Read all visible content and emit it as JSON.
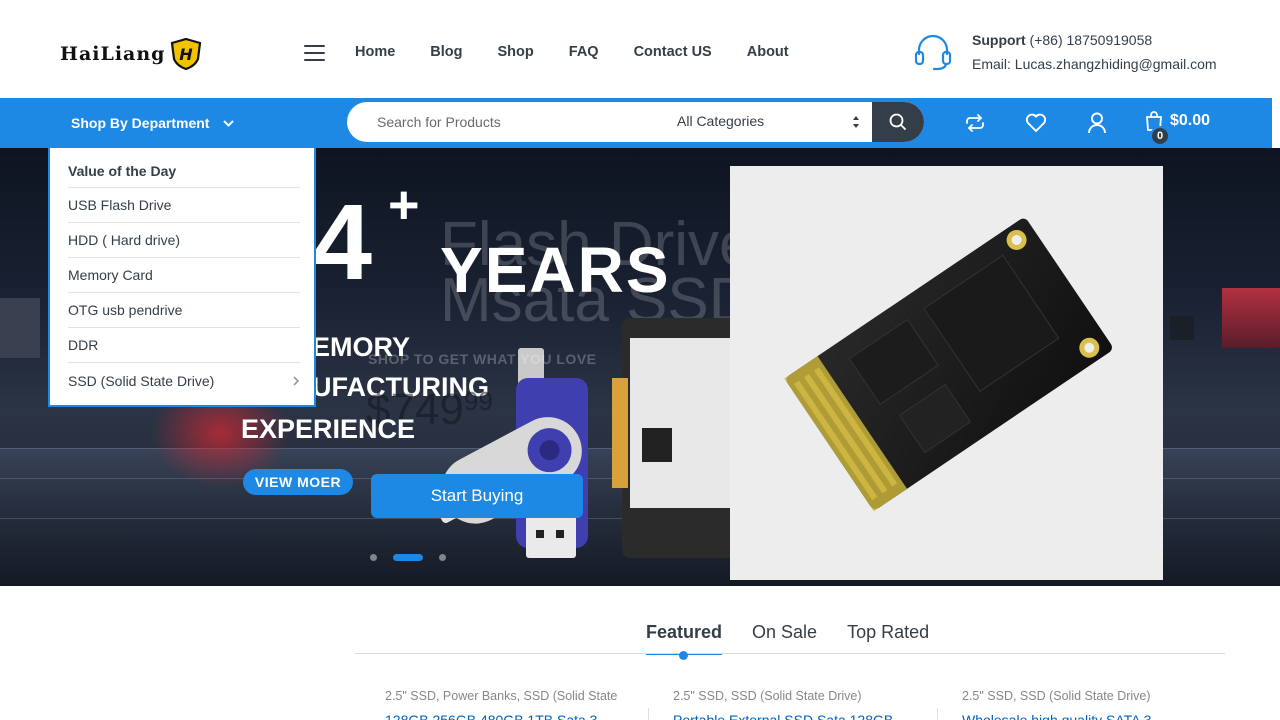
{
  "header": {
    "logo_text": "HaiLiang",
    "logo_badge_letter": "H",
    "nav": [
      "Home",
      "Blog",
      "Shop",
      "FAQ",
      "Contact US",
      "About"
    ],
    "support_label": "Support",
    "support_phone": "(+86) 18750919058",
    "support_email": "Email: Lucas.zhangzhiding@gmail.com"
  },
  "bar": {
    "department_label": "Shop By Department",
    "search_placeholder": "Search for Products",
    "category_selected": "All Categories",
    "cart_amount": "$0.00",
    "cart_count": "0"
  },
  "department_menu": [
    {
      "label": "Value of the Day",
      "has_sub": false
    },
    {
      "label": "USB Flash Drive",
      "has_sub": false
    },
    {
      "label": "HDD ( Hard drive)",
      "has_sub": false
    },
    {
      "label": "Memory Card",
      "has_sub": false
    },
    {
      "label": "OTG usb pendrive",
      "has_sub": false
    },
    {
      "label": "DDR",
      "has_sub": false
    },
    {
      "label": "SSD (Solid State Drive)",
      "has_sub": true
    }
  ],
  "hero": {
    "big_number": "4",
    "plus": "+",
    "years": "YEARS",
    "ghost_line1": "Flash Drive",
    "ghost_line2": "Msata SSD",
    "line_memory": "EMORY",
    "line_manuf": "UFACTURING",
    "line_experience": "EXPERIENCE",
    "shop_line": "SHOP TO GET WHAT YOU LOVE",
    "price_main": "$749",
    "price_cents": "99",
    "view_more": "VIEW MOER",
    "start_buying": "Start Buying",
    "slide_count": 3,
    "active_slide": 2
  },
  "tabs": [
    {
      "label": "Featured",
      "active": true
    },
    {
      "label": "On Sale",
      "active": false
    },
    {
      "label": "Top Rated",
      "active": false
    }
  ],
  "products": [
    {
      "categories": "2.5\" SSD, Power Banks, SSD (Solid State",
      "title": "128GB 256GB 480GB 1TB Sata 3"
    },
    {
      "categories": "2.5\" SSD, SSD (Solid State Drive)",
      "title": "Portable External SSD Sata 128GB"
    },
    {
      "categories": "2.5\" SSD, SSD (Solid State Drive)",
      "title": "Wholesale high quality SATA 3"
    }
  ],
  "colors": {
    "accent": "#1e88e5",
    "dark": "#333e48",
    "link": "#0062bd"
  }
}
